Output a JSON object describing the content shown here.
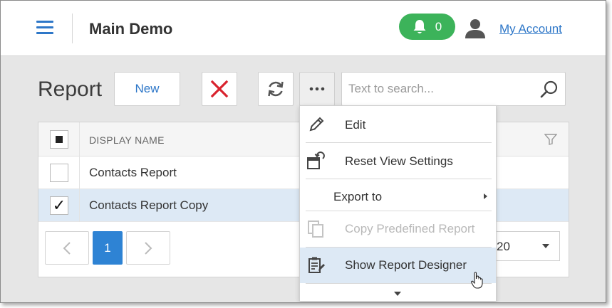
{
  "header": {
    "app_title": "Main Demo",
    "notifications_count": "0",
    "account_label": "My Account"
  },
  "toolbar": {
    "page_title": "Report",
    "new_label": "New",
    "search_placeholder": "Text to search..."
  },
  "grid": {
    "column_header": "DISPLAY NAME",
    "rows": [
      {
        "name": "Contacts Report",
        "checked": false
      },
      {
        "name": "Contacts Report Copy",
        "checked": true
      }
    ],
    "current_page": "1",
    "page_size": "20"
  },
  "menu": {
    "edit": "Edit",
    "reset_view": "Reset View Settings",
    "export_to": "Export to",
    "copy_predefined": "Copy Predefined Report",
    "show_designer": "Show Report Designer"
  },
  "colors": {
    "accent": "#2e77c8",
    "notification_green": "#3cb35a",
    "delete_red": "#d9232e",
    "selected_row": "#dde9f5"
  },
  "icons": [
    "hamburger-icon",
    "bell-icon",
    "user-icon",
    "delete-icon",
    "refresh-icon",
    "more-icon",
    "search-icon",
    "filter-icon",
    "edit-icon",
    "reset-view-icon",
    "copy-icon",
    "report-designer-icon"
  ]
}
